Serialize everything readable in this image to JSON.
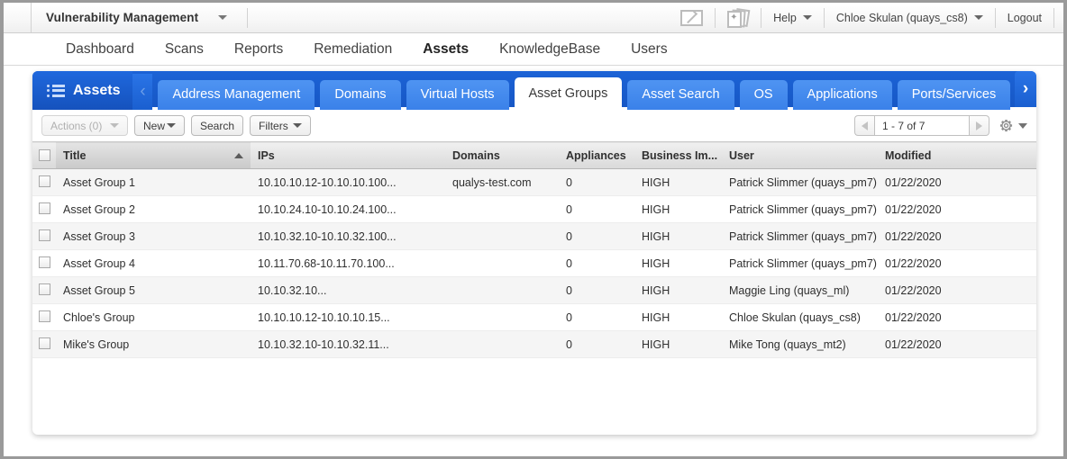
{
  "topbar": {
    "module": "Vulnerability Management",
    "mail_icon": "envelope-icon",
    "cards_icon": "news-cards-icon",
    "help": "Help",
    "user": "Chloe Skulan (quays_cs8)",
    "logout": "Logout"
  },
  "mainnav": {
    "items": [
      {
        "label": "Dashboard",
        "active": false
      },
      {
        "label": "Scans",
        "active": false
      },
      {
        "label": "Reports",
        "active": false
      },
      {
        "label": "Remediation",
        "active": false
      },
      {
        "label": "Assets",
        "active": true
      },
      {
        "label": "KnowledgeBase",
        "active": false
      },
      {
        "label": "Users",
        "active": false
      }
    ]
  },
  "module_tabs": {
    "badge_label": "Assets",
    "badge_icon": "list-icon",
    "scroll_left_icon": "chevron-left-icon",
    "scroll_right_icon": "chevron-right-icon",
    "tabs": [
      {
        "label": "Address Management",
        "active": false
      },
      {
        "label": "Domains",
        "active": false
      },
      {
        "label": "Virtual Hosts",
        "active": false
      },
      {
        "label": "Asset Groups",
        "active": true
      },
      {
        "label": "Asset Search",
        "active": false
      },
      {
        "label": "OS",
        "active": false
      },
      {
        "label": "Applications",
        "active": false
      },
      {
        "label": "Ports/Services",
        "active": false
      }
    ]
  },
  "toolbar": {
    "actions_label": "Actions (0)",
    "actions_disabled": true,
    "new_label": "New",
    "search_label": "Search",
    "filters_label": "Filters",
    "pager": {
      "prev_icon": "arrow-left-icon",
      "next_icon": "arrow-right-icon",
      "range": "1 - 7 of 7"
    },
    "settings_icon": "gear-icon"
  },
  "table": {
    "columns": [
      {
        "key": "check",
        "label": ""
      },
      {
        "key": "title",
        "label": "Title",
        "sorted": "asc"
      },
      {
        "key": "ips",
        "label": "IPs"
      },
      {
        "key": "domains",
        "label": "Domains"
      },
      {
        "key": "appliances",
        "label": "Appliances"
      },
      {
        "key": "business",
        "label": "Business Im..."
      },
      {
        "key": "user",
        "label": "User"
      },
      {
        "key": "modified",
        "label": "Modified"
      }
    ],
    "rows": [
      {
        "title": "Asset Group 1",
        "ips": "10.10.10.12-10.10.10.100...",
        "domains": "qualys-test.com",
        "appliances": "0",
        "business": "HIGH",
        "user": "Patrick Slimmer (quays_pm7)",
        "modified": "01/22/2020"
      },
      {
        "title": "Asset Group 2",
        "ips": "10.10.24.10-10.10.24.100...",
        "domains": "",
        "appliances": "0",
        "business": "HIGH",
        "user": "Patrick Slimmer (quays_pm7)",
        "modified": "01/22/2020"
      },
      {
        "title": "Asset Group 3",
        "ips": "10.10.32.10-10.10.32.100...",
        "domains": "",
        "appliances": "0",
        "business": "HIGH",
        "user": "Patrick Slimmer (quays_pm7)",
        "modified": "01/22/2020"
      },
      {
        "title": "Asset Group 4",
        "ips": "10.11.70.68-10.11.70.100...",
        "domains": "",
        "appliances": "0",
        "business": "HIGH",
        "user": "Patrick Slimmer (quays_pm7)",
        "modified": "01/22/2020"
      },
      {
        "title": "Asset Group 5",
        "ips": "10.10.32.10...",
        "domains": "",
        "appliances": "0",
        "business": "HIGH",
        "user": "Maggie Ling (quays_ml)",
        "modified": "01/22/2020"
      },
      {
        "title": "Chloe's Group",
        "ips": "10.10.10.12-10.10.10.15...",
        "domains": "",
        "appliances": "0",
        "business": "HIGH",
        "user": "Chloe Skulan (quays_cs8)",
        "modified": "01/22/2020"
      },
      {
        "title": "Mike's Group",
        "ips": "10.10.32.10-10.10.32.11...",
        "domains": "",
        "appliances": "0",
        "business": "HIGH",
        "user": "Mike Tong (quays_mt2)",
        "modified": "01/22/2020"
      }
    ]
  },
  "colors": {
    "tab_blue": "#1c63d6",
    "tab_light_blue": "#4f94f2",
    "page_bg": "#9a9a9a"
  }
}
